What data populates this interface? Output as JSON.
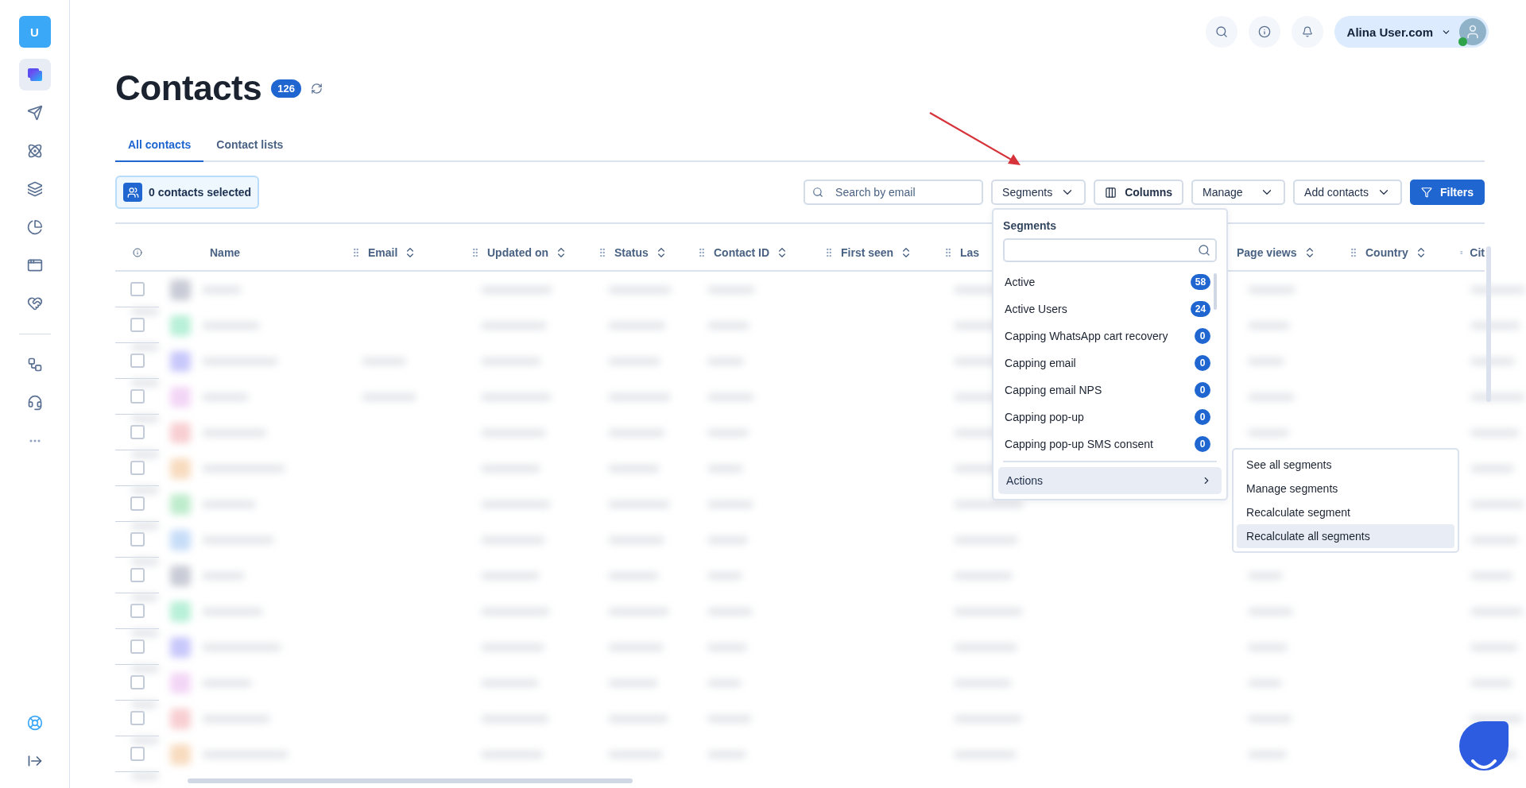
{
  "sidebar": {
    "logo": "U",
    "items": [
      {
        "selected": true
      },
      {
        "selected": false
      },
      {
        "selected": false
      },
      {
        "selected": false
      },
      {
        "selected": false
      },
      {
        "selected": false
      },
      {
        "selected": false
      }
    ],
    "more_items": [
      {
        "selected": false
      },
      {
        "selected": false
      },
      {
        "selected": false
      }
    ],
    "bottom_items": [
      {
        "selected": false
      },
      {
        "selected": false
      }
    ]
  },
  "header": {
    "user_name": "Alina User.com",
    "online": true
  },
  "page": {
    "title": "Contacts",
    "count": "126"
  },
  "tabs": [
    {
      "label": "All contacts",
      "selected": true
    },
    {
      "label": "Contact lists",
      "selected": false
    }
  ],
  "selection": {
    "label": "0 contacts selected"
  },
  "search": {
    "placeholder": "Search by email"
  },
  "toolbar_buttons": [
    {
      "label": "Segments",
      "kind": "dropdown"
    },
    {
      "label": "Columns",
      "kind": "columns"
    },
    {
      "label": "Manage",
      "kind": "dropdown"
    },
    {
      "label": "Add contacts",
      "kind": "dropdown"
    },
    {
      "label": "Filters",
      "kind": "primary"
    }
  ],
  "table": {
    "columns": [
      {
        "label": "Name",
        "sortable": false,
        "handle": false
      },
      {
        "label": "Email",
        "sortable": true,
        "handle": true
      },
      {
        "label": "Updated on",
        "sortable": true,
        "handle": true
      },
      {
        "label": "Status",
        "sortable": true,
        "handle": true
      },
      {
        "label": "Contact ID",
        "sortable": true,
        "handle": true
      },
      {
        "label": "First seen",
        "sortable": true,
        "handle": true
      },
      {
        "label": "Las",
        "sortable": false,
        "handle": true
      },
      {
        "label": "Page views",
        "sortable": true,
        "handle": false
      },
      {
        "label": "Country",
        "sortable": true,
        "handle": true
      },
      {
        "label": "Cit",
        "sortable": false,
        "handle": true
      }
    ],
    "rows": [
      {
        "checked": false,
        "color": "#c9ccd6"
      },
      {
        "checked": false,
        "color": "#b8f0d8"
      },
      {
        "checked": false,
        "color": "#c9c8fb"
      },
      {
        "checked": false,
        "color": "#f3d6f6"
      },
      {
        "checked": false,
        "color": "#f8cfd2"
      },
      {
        "checked": false,
        "color": "#f8dcc0"
      },
      {
        "checked": false,
        "color": "#bfeccd"
      },
      {
        "checked": false,
        "color": "#c7ddf8"
      },
      {
        "checked": false,
        "color": "#c9ccd6"
      },
      {
        "checked": false,
        "color": "#b8f0d8"
      },
      {
        "checked": false,
        "color": "#c9c8fb"
      },
      {
        "checked": false,
        "color": "#f3d6f6"
      },
      {
        "checked": false,
        "color": "#f8cfd2"
      },
      {
        "checked": false,
        "color": "#f8dcc0"
      }
    ]
  },
  "segments_menu": {
    "title": "Segments",
    "items": [
      {
        "label": "Active",
        "count": "58"
      },
      {
        "label": "Active Users",
        "count": "24"
      },
      {
        "label": "Capping WhatsApp cart recovery",
        "count": "0"
      },
      {
        "label": "Capping email",
        "count": "0"
      },
      {
        "label": "Capping email NPS",
        "count": "0"
      },
      {
        "label": "Capping pop-up",
        "count": "0"
      },
      {
        "label": "Capping pop-up SMS consent",
        "count": "0"
      }
    ],
    "actions": {
      "label": "Actions",
      "highlighted": true
    }
  },
  "actions_menu": {
    "items": [
      {
        "label": "See all segments",
        "selected": false
      },
      {
        "label": "Manage segments",
        "selected": false
      },
      {
        "label": "Recalculate segment",
        "selected": false
      },
      {
        "label": "Recalculate all segments",
        "selected": true
      }
    ]
  }
}
